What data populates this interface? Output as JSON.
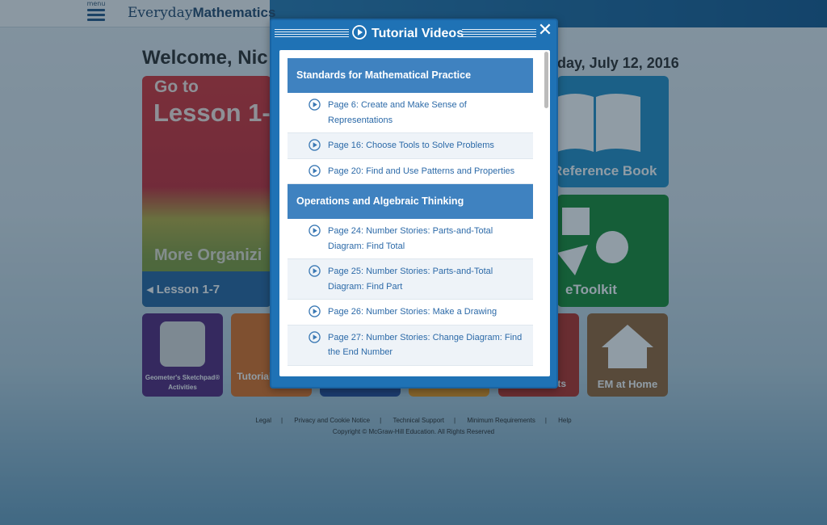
{
  "header": {
    "menu_label": "menu",
    "brand_light": "Everyday",
    "brand_bold": "Mathematics"
  },
  "page": {
    "welcome": "Welcome, Nic",
    "date": "day, July 12, 2016",
    "lesson_tile": {
      "goto": "Go to",
      "lesson": "Lesson 1-",
      "subtitle": "More Organizi",
      "prev_lesson": "◂ Lesson 1-7"
    },
    "reference_book": "Reference Book",
    "etoolkit": "eToolkit",
    "tiles": {
      "geometers": "Geometer's Sketchpad® Activities",
      "tutorial": "Tutorial Videos",
      "red_tile": "ts",
      "em_home": "EM at Home"
    }
  },
  "footer": {
    "links": [
      "Legal",
      "Privacy and Cookie Notice",
      "Technical Support",
      "Minimum Requirements",
      "Help"
    ],
    "copyright": "Copyright © McGraw-Hill Education. All Rights Reserved"
  },
  "modal": {
    "title": "Tutorial Videos",
    "close": "✕",
    "sections": [
      {
        "heading": "Standards for Mathematical Practice",
        "items": [
          "Page 6: Create and Make Sense of Representations",
          "Page 16: Choose Tools to Solve Problems",
          "Page 20: Find and Use Patterns and Properties"
        ]
      },
      {
        "heading": "Operations and Algebraic Thinking",
        "items": [
          "Page 24: Number Stories: Parts-and-Total Diagram: Find Total",
          "Page 25: Number Stories: Parts-and-Total Diagram: Find Part",
          "Page 26: Number Stories: Make a Drawing",
          "Page 27: Number Stories: Change Diagram: Find the End Number"
        ]
      }
    ]
  },
  "colors": {
    "modal_frame": "#1f72b5",
    "section_heading": "#3f82c0",
    "link_text": "#2c6aa8"
  }
}
